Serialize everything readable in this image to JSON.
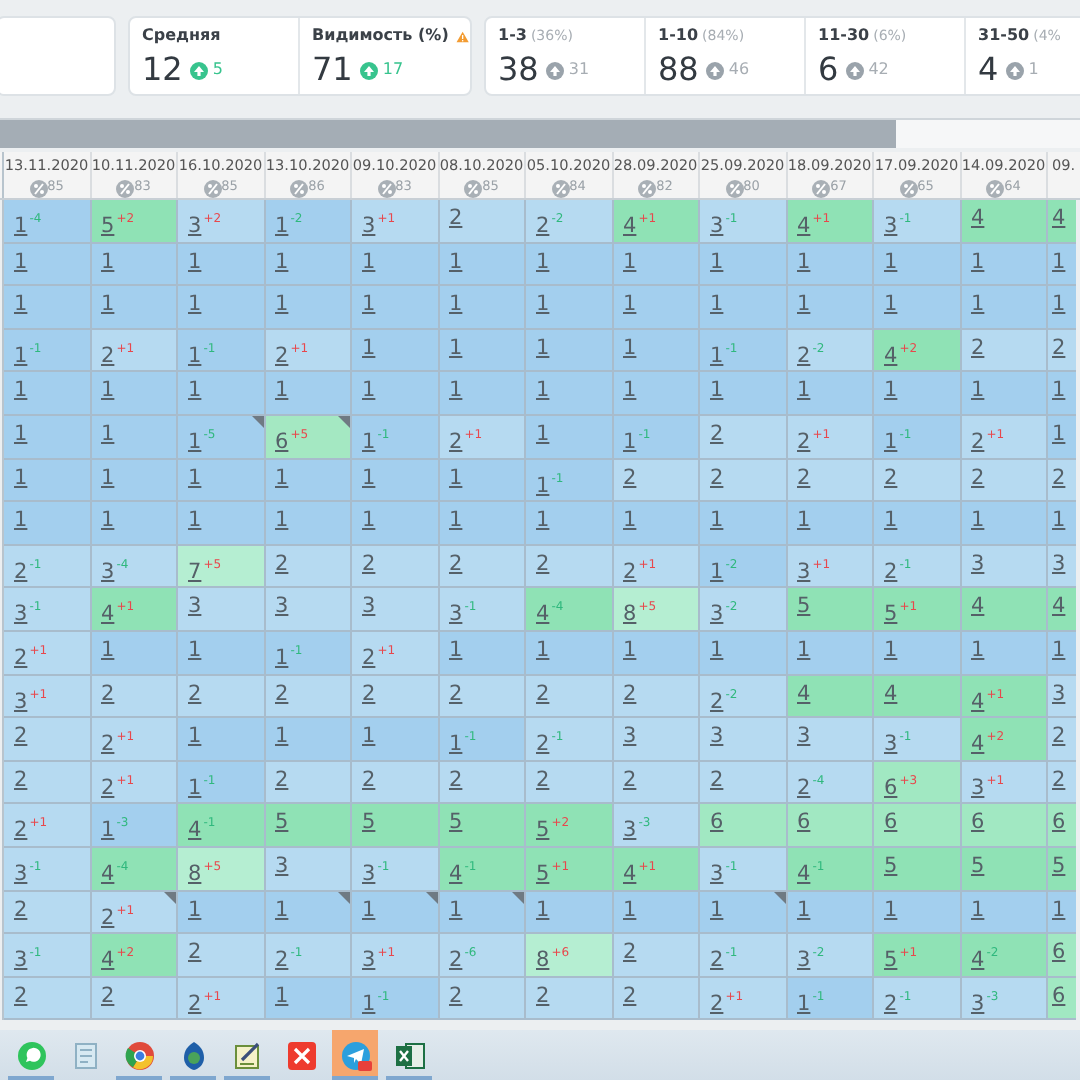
{
  "summary_groups": [
    {
      "cells": [
        {
          "label": "Средняя",
          "value": "12",
          "change": "5",
          "positive": true,
          "warning": false
        },
        {
          "label": "Видимость (%)",
          "value": "71",
          "change": "17",
          "positive": true,
          "warning": true
        }
      ]
    },
    {
      "cells": [
        {
          "label": "1-3",
          "share": "(36%)",
          "value": "38",
          "change": "31",
          "positive": false
        },
        {
          "label": "1-10",
          "share": "(84%)",
          "value": "88",
          "change": "46",
          "positive": false
        },
        {
          "label": "11-30",
          "share": "(6%)",
          "value": "6",
          "change": "42",
          "positive": false
        },
        {
          "label": "31-50",
          "share": "(4%",
          "value": "4",
          "change": "1",
          "positive": false
        }
      ]
    }
  ],
  "scrollbar": {
    "level": 0.83
  },
  "columns": [
    {
      "date": "13.11.2020",
      "visibility": "85"
    },
    {
      "date": "10.11.2020",
      "visibility": "83"
    },
    {
      "date": "16.10.2020",
      "visibility": "85"
    },
    {
      "date": "13.10.2020",
      "visibility": "86"
    },
    {
      "date": "09.10.2020",
      "visibility": "83"
    },
    {
      "date": "08.10.2020",
      "visibility": "85"
    },
    {
      "date": "05.10.2020",
      "visibility": "84"
    },
    {
      "date": "28.09.2020",
      "visibility": "82"
    },
    {
      "date": "25.09.2020",
      "visibility": "80"
    },
    {
      "date": "18.09.2020",
      "visibility": "67"
    },
    {
      "date": "17.09.2020",
      "visibility": "65"
    },
    {
      "date": "14.09.2020",
      "visibility": "64"
    },
    {
      "date": "09."
    }
  ],
  "rows": [
    {
      "cells": [
        {
          "v": "1",
          "d": "-4",
          "rise": false,
          "color": "#a3cfee"
        },
        {
          "v": "5",
          "d": "+2",
          "rise": true,
          "color": "#8fe2b5"
        },
        {
          "v": "3",
          "d": "+2",
          "rise": true,
          "color": "#b6daf1"
        },
        {
          "v": "1",
          "d": "-2",
          "rise": false,
          "color": "#a3cfee"
        },
        {
          "v": "3",
          "d": "+1",
          "rise": true,
          "color": "#b6daf1"
        },
        {
          "v": "2",
          "color": "#b6daf1"
        },
        {
          "v": "2",
          "d": "-2",
          "rise": false,
          "color": "#b6daf1"
        },
        {
          "v": "4",
          "d": "+1",
          "rise": true,
          "color": "#8fe2b5"
        },
        {
          "v": "3",
          "d": "-1",
          "rise": false,
          "color": "#b6daf1"
        },
        {
          "v": "4",
          "d": "+1",
          "rise": true,
          "color": "#8fe2b5"
        },
        {
          "v": "3",
          "d": "-1",
          "rise": false,
          "color": "#b6daf1"
        },
        {
          "v": "4",
          "color": "#8fe2b5"
        },
        {
          "v": "4",
          "color": "#8fe2b5"
        }
      ]
    },
    {
      "cells": [
        {
          "v": "1",
          "color": "#a3cfee"
        },
        {
          "v": "1",
          "color": "#a3cfee"
        },
        {
          "v": "1",
          "color": "#a3cfee"
        },
        {
          "v": "1",
          "color": "#a3cfee"
        },
        {
          "v": "1",
          "color": "#a3cfee"
        },
        {
          "v": "1",
          "color": "#a3cfee"
        },
        {
          "v": "1",
          "color": "#a3cfee"
        },
        {
          "v": "1",
          "color": "#a3cfee"
        },
        {
          "v": "1",
          "color": "#a3cfee"
        },
        {
          "v": "1",
          "color": "#a3cfee"
        },
        {
          "v": "1",
          "color": "#a3cfee"
        },
        {
          "v": "1",
          "color": "#a3cfee"
        },
        {
          "v": "1",
          "color": "#a3cfee"
        }
      ]
    },
    {
      "cells": [
        {
          "v": "1",
          "color": "#a3cfee"
        },
        {
          "v": "1",
          "color": "#a3cfee"
        },
        {
          "v": "1",
          "color": "#a3cfee"
        },
        {
          "v": "1",
          "color": "#a3cfee"
        },
        {
          "v": "1",
          "color": "#a3cfee"
        },
        {
          "v": "1",
          "color": "#a3cfee"
        },
        {
          "v": "1",
          "color": "#a3cfee"
        },
        {
          "v": "1",
          "color": "#a3cfee"
        },
        {
          "v": "1",
          "color": "#a3cfee"
        },
        {
          "v": "1",
          "color": "#a3cfee"
        },
        {
          "v": "1",
          "color": "#a3cfee"
        },
        {
          "v": "1",
          "color": "#a3cfee"
        },
        {
          "v": "1",
          "color": "#a3cfee"
        }
      ]
    },
    {
      "cells": [
        {
          "v": "1",
          "d": "-1",
          "rise": false,
          "color": "#a3cfee"
        },
        {
          "v": "2",
          "d": "+1",
          "rise": true,
          "color": "#b6daf1"
        },
        {
          "v": "1",
          "d": "-1",
          "rise": false,
          "color": "#a3cfee"
        },
        {
          "v": "2",
          "d": "+1",
          "rise": true,
          "color": "#b6daf1"
        },
        {
          "v": "1",
          "color": "#a3cfee"
        },
        {
          "v": "1",
          "color": "#a3cfee"
        },
        {
          "v": "1",
          "color": "#a3cfee"
        },
        {
          "v": "1",
          "color": "#a3cfee"
        },
        {
          "v": "1",
          "d": "-1",
          "rise": false,
          "color": "#a3cfee"
        },
        {
          "v": "2",
          "d": "-2",
          "rise": false,
          "color": "#b6daf1"
        },
        {
          "v": "4",
          "d": "+2",
          "rise": true,
          "color": "#8fe2b5"
        },
        {
          "v": "2",
          "color": "#b6daf1"
        },
        {
          "v": "2",
          "color": "#b6daf1"
        }
      ]
    },
    {
      "cells": [
        {
          "v": "1",
          "color": "#a3cfee"
        },
        {
          "v": "1",
          "color": "#a3cfee"
        },
        {
          "v": "1",
          "color": "#a3cfee"
        },
        {
          "v": "1",
          "color": "#a3cfee"
        },
        {
          "v": "1",
          "color": "#a3cfee"
        },
        {
          "v": "1",
          "color": "#a3cfee"
        },
        {
          "v": "1",
          "color": "#a3cfee"
        },
        {
          "v": "1",
          "color": "#a3cfee"
        },
        {
          "v": "1",
          "color": "#a3cfee"
        },
        {
          "v": "1",
          "color": "#a3cfee"
        },
        {
          "v": "1",
          "color": "#a3cfee"
        },
        {
          "v": "1",
          "color": "#a3cfee"
        },
        {
          "v": "1",
          "color": "#a3cfee"
        }
      ]
    },
    {
      "cells": [
        {
          "v": "1",
          "color": "#a3cfee"
        },
        {
          "v": "1",
          "color": "#a3cfee"
        },
        {
          "v": "1",
          "d": "-5",
          "rise": false,
          "color": "#a3cfee",
          "note": true
        },
        {
          "v": "6",
          "d": "+5",
          "rise": true,
          "color": "#a4e8c2",
          "note": true
        },
        {
          "v": "1",
          "d": "-1",
          "rise": false,
          "color": "#a3cfee"
        },
        {
          "v": "2",
          "d": "+1",
          "rise": true,
          "color": "#b6daf1"
        },
        {
          "v": "1",
          "color": "#a3cfee"
        },
        {
          "v": "1",
          "d": "-1",
          "rise": false,
          "color": "#a3cfee"
        },
        {
          "v": "2",
          "color": "#b6daf1"
        },
        {
          "v": "2",
          "d": "+1",
          "rise": true,
          "color": "#b6daf1"
        },
        {
          "v": "1",
          "d": "-1",
          "rise": false,
          "color": "#a3cfee"
        },
        {
          "v": "2",
          "d": "+1",
          "rise": true,
          "color": "#b6daf1"
        },
        {
          "v": "1",
          "color": "#a3cfee"
        }
      ]
    },
    {
      "cells": [
        {
          "v": "1",
          "color": "#a3cfee"
        },
        {
          "v": "1",
          "color": "#a3cfee"
        },
        {
          "v": "1",
          "color": "#a3cfee"
        },
        {
          "v": "1",
          "color": "#a3cfee"
        },
        {
          "v": "1",
          "color": "#a3cfee"
        },
        {
          "v": "1",
          "color": "#a3cfee"
        },
        {
          "v": "1",
          "d": "-1",
          "rise": false,
          "color": "#a3cfee"
        },
        {
          "v": "2",
          "color": "#b6daf1"
        },
        {
          "v": "2",
          "color": "#b6daf1"
        },
        {
          "v": "2",
          "color": "#b6daf1"
        },
        {
          "v": "2",
          "color": "#b6daf1"
        },
        {
          "v": "2",
          "color": "#b6daf1"
        },
        {
          "v": "2",
          "color": "#b6daf1"
        }
      ]
    },
    {
      "cells": [
        {
          "v": "1",
          "color": "#a3cfee"
        },
        {
          "v": "1",
          "color": "#a3cfee"
        },
        {
          "v": "1",
          "color": "#a3cfee"
        },
        {
          "v": "1",
          "color": "#a3cfee"
        },
        {
          "v": "1",
          "color": "#a3cfee"
        },
        {
          "v": "1",
          "color": "#a3cfee"
        },
        {
          "v": "1",
          "color": "#a3cfee"
        },
        {
          "v": "1",
          "color": "#a3cfee"
        },
        {
          "v": "1",
          "color": "#a3cfee"
        },
        {
          "v": "1",
          "color": "#a3cfee"
        },
        {
          "v": "1",
          "color": "#a3cfee"
        },
        {
          "v": "1",
          "color": "#a3cfee"
        },
        {
          "v": "1",
          "color": "#a3cfee"
        }
      ]
    },
    {
      "cells": [
        {
          "v": "2",
          "d": "-1",
          "rise": false,
          "color": "#b6daf1"
        },
        {
          "v": "3",
          "d": "-4",
          "rise": false,
          "color": "#b6daf1"
        },
        {
          "v": "7",
          "d": "+5",
          "rise": true,
          "color": "#b5eed2"
        },
        {
          "v": "2",
          "color": "#b6daf1"
        },
        {
          "v": "2",
          "color": "#b6daf1"
        },
        {
          "v": "2",
          "color": "#b6daf1"
        },
        {
          "v": "2",
          "color": "#b6daf1"
        },
        {
          "v": "2",
          "d": "+1",
          "rise": true,
          "color": "#b6daf1"
        },
        {
          "v": "1",
          "d": "-2",
          "rise": false,
          "color": "#a3cfee"
        },
        {
          "v": "3",
          "d": "+1",
          "rise": true,
          "color": "#b6daf1"
        },
        {
          "v": "2",
          "d": "-1",
          "rise": false,
          "color": "#b6daf1"
        },
        {
          "v": "3",
          "color": "#b6daf1"
        },
        {
          "v": "3",
          "color": "#b6daf1"
        }
      ]
    },
    {
      "cells": [
        {
          "v": "3",
          "d": "-1",
          "rise": false,
          "color": "#b6daf1"
        },
        {
          "v": "4",
          "d": "+1",
          "rise": true,
          "color": "#8fe2b5"
        },
        {
          "v": "3",
          "color": "#b6daf1"
        },
        {
          "v": "3",
          "color": "#b6daf1"
        },
        {
          "v": "3",
          "color": "#b6daf1"
        },
        {
          "v": "3",
          "d": "-1",
          "rise": false,
          "color": "#b6daf1"
        },
        {
          "v": "4",
          "d": "-4",
          "rise": false,
          "color": "#8fe2b5"
        },
        {
          "v": "8",
          "d": "+5",
          "rise": true,
          "color": "#b5eed2"
        },
        {
          "v": "3",
          "d": "-2",
          "rise": false,
          "color": "#b6daf1"
        },
        {
          "v": "5",
          "color": "#8fe2b5"
        },
        {
          "v": "5",
          "d": "+1",
          "rise": true,
          "color": "#8fe2b5"
        },
        {
          "v": "4",
          "color": "#8fe2b5"
        },
        {
          "v": "4",
          "color": "#8fe2b5"
        }
      ]
    },
    {
      "cells": [
        {
          "v": "2",
          "d": "+1",
          "rise": true,
          "color": "#b6daf1"
        },
        {
          "v": "1",
          "color": "#a3cfee"
        },
        {
          "v": "1",
          "color": "#a3cfee"
        },
        {
          "v": "1",
          "d": "-1",
          "rise": false,
          "color": "#a3cfee"
        },
        {
          "v": "2",
          "d": "+1",
          "rise": true,
          "color": "#b6daf1"
        },
        {
          "v": "1",
          "color": "#a3cfee"
        },
        {
          "v": "1",
          "color": "#a3cfee"
        },
        {
          "v": "1",
          "color": "#a3cfee"
        },
        {
          "v": "1",
          "color": "#a3cfee"
        },
        {
          "v": "1",
          "color": "#a3cfee"
        },
        {
          "v": "1",
          "color": "#a3cfee"
        },
        {
          "v": "1",
          "color": "#a3cfee"
        },
        {
          "v": "1",
          "color": "#a3cfee"
        }
      ]
    },
    {
      "cells": [
        {
          "v": "3",
          "d": "+1",
          "rise": true,
          "color": "#b6daf1"
        },
        {
          "v": "2",
          "color": "#b6daf1"
        },
        {
          "v": "2",
          "color": "#b6daf1"
        },
        {
          "v": "2",
          "color": "#b6daf1"
        },
        {
          "v": "2",
          "color": "#b6daf1"
        },
        {
          "v": "2",
          "color": "#b6daf1"
        },
        {
          "v": "2",
          "color": "#b6daf1"
        },
        {
          "v": "2",
          "color": "#b6daf1"
        },
        {
          "v": "2",
          "d": "-2",
          "rise": false,
          "color": "#b6daf1"
        },
        {
          "v": "4",
          "color": "#8fe2b5"
        },
        {
          "v": "4",
          "color": "#8fe2b5"
        },
        {
          "v": "4",
          "d": "+1",
          "rise": true,
          "color": "#8fe2b5"
        },
        {
          "v": "3",
          "color": "#b6daf1"
        }
      ]
    },
    {
      "cells": [
        {
          "v": "2",
          "color": "#b6daf1"
        },
        {
          "v": "2",
          "d": "+1",
          "rise": true,
          "color": "#b6daf1"
        },
        {
          "v": "1",
          "color": "#a3cfee"
        },
        {
          "v": "1",
          "color": "#a3cfee"
        },
        {
          "v": "1",
          "color": "#a3cfee"
        },
        {
          "v": "1",
          "d": "-1",
          "rise": false,
          "color": "#a3cfee"
        },
        {
          "v": "2",
          "d": "-1",
          "rise": false,
          "color": "#b6daf1"
        },
        {
          "v": "3",
          "color": "#b6daf1"
        },
        {
          "v": "3",
          "color": "#b6daf1"
        },
        {
          "v": "3",
          "color": "#b6daf1"
        },
        {
          "v": "3",
          "d": "-1",
          "rise": false,
          "color": "#b6daf1"
        },
        {
          "v": "4",
          "d": "+2",
          "rise": true,
          "color": "#8fe2b5"
        },
        {
          "v": "2",
          "color": "#b6daf1"
        }
      ]
    },
    {
      "cells": [
        {
          "v": "2",
          "color": "#b6daf1"
        },
        {
          "v": "2",
          "d": "+1",
          "rise": true,
          "color": "#b6daf1"
        },
        {
          "v": "1",
          "d": "-1",
          "rise": false,
          "color": "#a3cfee"
        },
        {
          "v": "2",
          "color": "#b6daf1"
        },
        {
          "v": "2",
          "color": "#b6daf1"
        },
        {
          "v": "2",
          "color": "#b6daf1"
        },
        {
          "v": "2",
          "color": "#b6daf1"
        },
        {
          "v": "2",
          "color": "#b6daf1"
        },
        {
          "v": "2",
          "color": "#b6daf1"
        },
        {
          "v": "2",
          "d": "-4",
          "rise": false,
          "color": "#b6daf1"
        },
        {
          "v": "6",
          "d": "+3",
          "rise": true,
          "color": "#a1e8c2"
        },
        {
          "v": "3",
          "d": "+1",
          "rise": true,
          "color": "#b6daf1"
        },
        {
          "v": "2",
          "color": "#b6daf1"
        }
      ]
    },
    {
      "cells": [
        {
          "v": "2",
          "d": "+1",
          "rise": true,
          "color": "#b6daf1"
        },
        {
          "v": "1",
          "d": "-3",
          "rise": false,
          "color": "#a3cfee"
        },
        {
          "v": "4",
          "d": "-1",
          "rise": false,
          "color": "#8fe2b5"
        },
        {
          "v": "5",
          "color": "#8fe2b5"
        },
        {
          "v": "5",
          "color": "#8fe2b5"
        },
        {
          "v": "5",
          "color": "#8fe2b5"
        },
        {
          "v": "5",
          "d": "+2",
          "rise": true,
          "color": "#8fe2b5"
        },
        {
          "v": "3",
          "d": "-3",
          "rise": false,
          "color": "#b6daf1"
        },
        {
          "v": "6",
          "color": "#a1e8c2"
        },
        {
          "v": "6",
          "color": "#a1e8c2"
        },
        {
          "v": "6",
          "color": "#a1e8c2"
        },
        {
          "v": "6",
          "color": "#a1e8c2"
        },
        {
          "v": "6",
          "color": "#a1e8c2"
        }
      ]
    },
    {
      "cells": [
        {
          "v": "3",
          "d": "-1",
          "rise": false,
          "color": "#b6daf1"
        },
        {
          "v": "4",
          "d": "-4",
          "rise": false,
          "color": "#8fe2b5"
        },
        {
          "v": "8",
          "d": "+5",
          "rise": true,
          "color": "#b5eed2"
        },
        {
          "v": "3",
          "color": "#b6daf1"
        },
        {
          "v": "3",
          "d": "-1",
          "rise": false,
          "color": "#b6daf1"
        },
        {
          "v": "4",
          "d": "-1",
          "rise": false,
          "color": "#8fe2b5"
        },
        {
          "v": "5",
          "d": "+1",
          "rise": true,
          "color": "#8fe2b5"
        },
        {
          "v": "4",
          "d": "+1",
          "rise": true,
          "color": "#8fe2b5"
        },
        {
          "v": "3",
          "d": "-1",
          "rise": false,
          "color": "#b6daf1"
        },
        {
          "v": "4",
          "d": "-1",
          "rise": false,
          "color": "#8fe2b5"
        },
        {
          "v": "5",
          "color": "#8fe2b5"
        },
        {
          "v": "5",
          "color": "#8fe2b5"
        },
        {
          "v": "5",
          "color": "#8fe2b5"
        }
      ]
    },
    {
      "cells": [
        {
          "v": "2",
          "color": "#b6daf1"
        },
        {
          "v": "2",
          "d": "+1",
          "rise": true,
          "color": "#b6daf1",
          "note": true
        },
        {
          "v": "1",
          "color": "#a3cfee"
        },
        {
          "v": "1",
          "color": "#a3cfee",
          "note": true
        },
        {
          "v": "1",
          "color": "#a3cfee",
          "note": true
        },
        {
          "v": "1",
          "color": "#a3cfee",
          "note": true
        },
        {
          "v": "1",
          "color": "#a3cfee"
        },
        {
          "v": "1",
          "color": "#a3cfee"
        },
        {
          "v": "1",
          "color": "#a3cfee",
          "note": true
        },
        {
          "v": "1",
          "color": "#a3cfee"
        },
        {
          "v": "1",
          "color": "#a3cfee"
        },
        {
          "v": "1",
          "color": "#a3cfee"
        },
        {
          "v": "1",
          "color": "#a3cfee"
        }
      ]
    },
    {
      "cells": [
        {
          "v": "3",
          "d": "-1",
          "rise": false,
          "color": "#b6daf1"
        },
        {
          "v": "4",
          "d": "+2",
          "rise": true,
          "color": "#8fe2b5"
        },
        {
          "v": "2",
          "color": "#b6daf1"
        },
        {
          "v": "2",
          "d": "-1",
          "rise": false,
          "color": "#b6daf1"
        },
        {
          "v": "3",
          "d": "+1",
          "rise": true,
          "color": "#b6daf1"
        },
        {
          "v": "2",
          "d": "-6",
          "rise": false,
          "color": "#b6daf1"
        },
        {
          "v": "8",
          "d": "+6",
          "rise": true,
          "color": "#b5eed2"
        },
        {
          "v": "2",
          "color": "#b6daf1"
        },
        {
          "v": "2",
          "d": "-1",
          "rise": false,
          "color": "#b6daf1"
        },
        {
          "v": "3",
          "d": "-2",
          "rise": false,
          "color": "#b6daf1"
        },
        {
          "v": "5",
          "d": "+1",
          "rise": true,
          "color": "#8fe2b5"
        },
        {
          "v": "4",
          "d": "-2",
          "rise": false,
          "color": "#8fe2b5"
        },
        {
          "v": "6",
          "color": "#a1e8c2"
        }
      ]
    },
    {
      "cells": [
        {
          "v": "2",
          "color": "#b6daf1"
        },
        {
          "v": "2",
          "color": "#b6daf1"
        },
        {
          "v": "2",
          "d": "+1",
          "rise": true,
          "color": "#b6daf1"
        },
        {
          "v": "1",
          "color": "#a3cfee"
        },
        {
          "v": "1",
          "d": "-1",
          "rise": false,
          "color": "#a3cfee"
        },
        {
          "v": "2",
          "color": "#b6daf1"
        },
        {
          "v": "2",
          "color": "#b6daf1"
        },
        {
          "v": "2",
          "color": "#b6daf1"
        },
        {
          "v": "2",
          "d": "+1",
          "rise": true,
          "color": "#b6daf1"
        },
        {
          "v": "1",
          "d": "-1",
          "rise": false,
          "color": "#a3cfee"
        },
        {
          "v": "2",
          "d": "-1",
          "rise": false,
          "color": "#b6daf1"
        },
        {
          "v": "3",
          "d": "-3",
          "rise": false,
          "color": "#b6daf1"
        },
        {
          "v": "6",
          "color": "#a1e8c2"
        }
      ]
    }
  ],
  "taskbar": [
    {
      "kind": "chat",
      "running": true,
      "selected": false
    },
    {
      "kind": "notepad",
      "running": false,
      "selected": false
    },
    {
      "kind": "browser",
      "running": true,
      "selected": false
    },
    {
      "kind": "shield",
      "running": true,
      "selected": false
    },
    {
      "kind": "editor",
      "running": true,
      "selected": false
    },
    {
      "kind": "close",
      "running": false,
      "selected": false
    },
    {
      "kind": "messenger",
      "running": true,
      "selected": true
    },
    {
      "kind": "spreadsheet",
      "running": true,
      "selected": false
    }
  ]
}
